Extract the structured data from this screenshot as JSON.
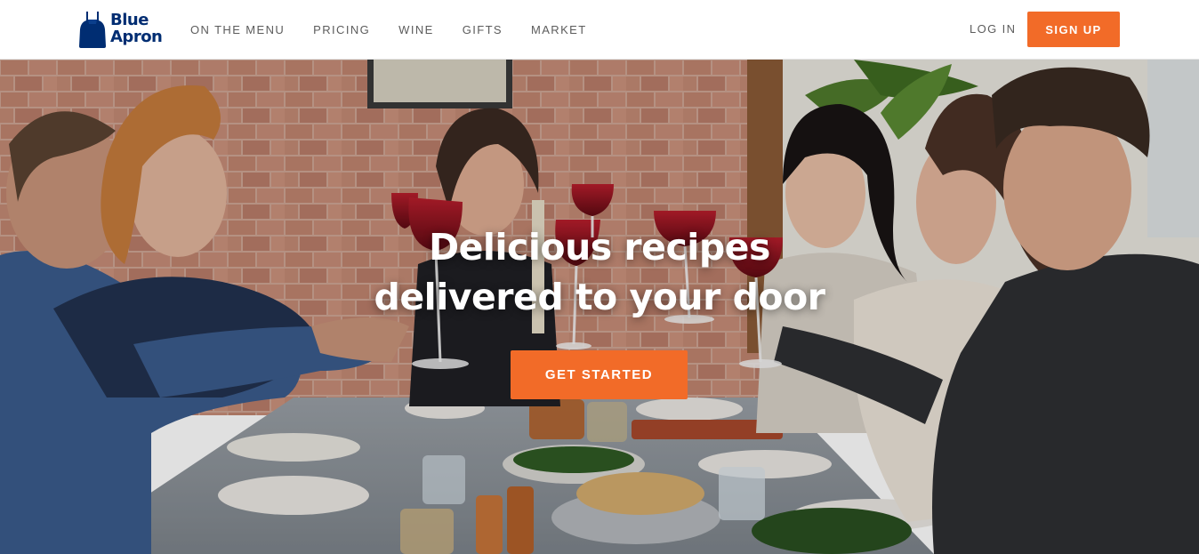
{
  "brand": {
    "name_line1": "Blue",
    "name_line2": "Apron",
    "logo_icon": "apron-icon",
    "color": "#002d72"
  },
  "nav": {
    "items": [
      {
        "label": "ON THE MENU"
      },
      {
        "label": "PRICING"
      },
      {
        "label": "WINE"
      },
      {
        "label": "GIFTS"
      },
      {
        "label": "MARKET"
      }
    ],
    "login_label": "LOG IN",
    "signup_label": "SIGN UP"
  },
  "hero": {
    "title_line1": "Delicious recipes",
    "title_line2": "delivered to your door",
    "cta_label": "GET STARTED",
    "image_subject": "friends-toasting-wine-at-dinner-table"
  },
  "colors": {
    "accent": "#f26b28",
    "nav_text": "#5c5c5c",
    "brand_blue": "#002d72"
  }
}
